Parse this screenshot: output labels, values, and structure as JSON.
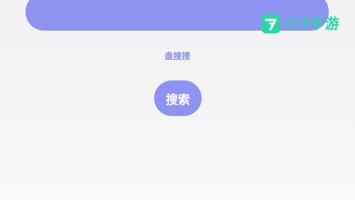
{
  "search": {
    "placeholder": "",
    "value": ""
  },
  "site": {
    "label": "盘搜搜"
  },
  "actions": {
    "search_label": "搜索"
  },
  "watermark": {
    "text": "小7手游",
    "logo_digit": "7",
    "icon": "logo-7-icon"
  },
  "colors": {
    "accent": "#8e92f0",
    "label": "#8e92e8",
    "watermark": "#2dd5a6",
    "background": "#f4f4f5"
  }
}
